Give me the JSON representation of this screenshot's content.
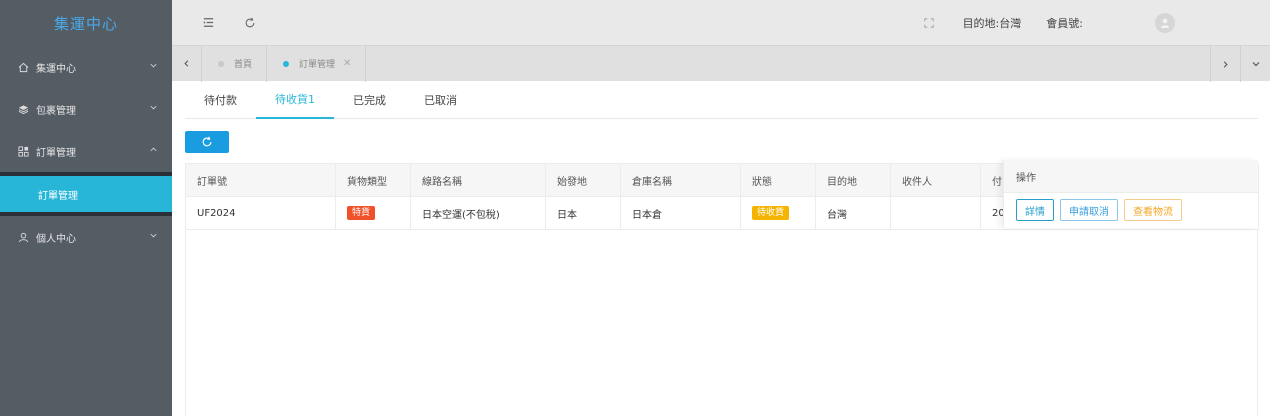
{
  "sidebar": {
    "brand": "集運中心",
    "menu": [
      {
        "label": "集運中心",
        "icon": "home-icon"
      },
      {
        "label": "包裹管理",
        "icon": "box-icon"
      },
      {
        "label": "訂單管理",
        "icon": "grid-icon"
      },
      {
        "label": "個人中心",
        "icon": "user-icon"
      }
    ],
    "submenu_active": "訂單管理"
  },
  "topbar": {
    "destination": "目的地:台灣",
    "member": "會員號:"
  },
  "tags": [
    {
      "label": "首頁"
    },
    {
      "label": "訂單管理"
    }
  ],
  "subtabs": [
    "待付款",
    "待收貨1",
    "已完成",
    "已取消"
  ],
  "table": {
    "columns": [
      "訂單號",
      "貨物類型",
      "線路名稱",
      "始發地",
      "倉庫名稱",
      "狀態",
      "目的地",
      "收件人",
      "付"
    ],
    "rows": [
      {
        "order_no": "UF2024",
        "cargo_type": "特貨",
        "route": "日本空運(不包稅)",
        "origin": "日本",
        "warehouse": "日本倉",
        "status": "待收貨",
        "destination": "台灣",
        "recipient": "",
        "pay": "20"
      }
    ]
  },
  "ops": {
    "header": "操作",
    "detail": "詳情",
    "cancel": "申請取消",
    "logistics": "查看物流"
  },
  "colors": {
    "accent": "#27b6d8",
    "primary": "#1a9de0",
    "danger_badge": "#f0502a",
    "warning_badge": "#f5b400"
  }
}
